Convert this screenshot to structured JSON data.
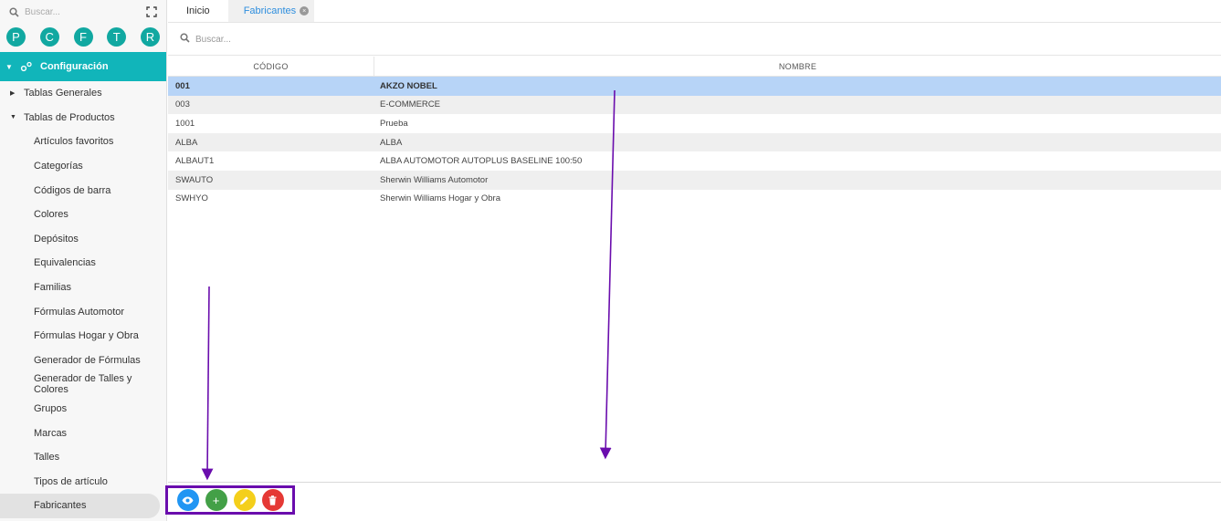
{
  "sidebar": {
    "search_placeholder": "Buscar...",
    "shortcuts": [
      "P",
      "C",
      "F",
      "T",
      "R"
    ],
    "section_title": "Configuración",
    "groups": [
      {
        "label": "Tablas Generales"
      },
      {
        "label": "Tablas de Productos"
      }
    ],
    "items": [
      {
        "label": "Artículos favoritos"
      },
      {
        "label": "Categorías"
      },
      {
        "label": "Códigos de barra"
      },
      {
        "label": "Colores"
      },
      {
        "label": "Depósitos"
      },
      {
        "label": "Equivalencias"
      },
      {
        "label": "Familias"
      },
      {
        "label": "Fórmulas Automotor"
      },
      {
        "label": "Fórmulas Hogar y Obra"
      },
      {
        "label": "Generador de Fórmulas"
      },
      {
        "label": "Generador de Talles y Colores"
      },
      {
        "label": "Grupos"
      },
      {
        "label": "Marcas"
      },
      {
        "label": "Talles"
      },
      {
        "label": "Tipos de artículo"
      },
      {
        "label": "Fabricantes"
      }
    ]
  },
  "tabs": [
    {
      "label": "Inicio"
    },
    {
      "label": "Fabricantes",
      "close": "×"
    }
  ],
  "main": {
    "search_placeholder": "Buscar...",
    "columns": [
      "CÓDIGO",
      "NOMBRE"
    ],
    "rows": [
      {
        "code": "001",
        "name": "AKZO NOBEL"
      },
      {
        "code": "003",
        "name": "E-COMMERCE"
      },
      {
        "code": "1001",
        "name": "Prueba"
      },
      {
        "code": "ALBA",
        "name": "ALBA"
      },
      {
        "code": "ALBAUT1",
        "name": "ALBA AUTOMOTOR AUTOPLUS BASELINE 100:50"
      },
      {
        "code": "SWAUTO",
        "name": "Sherwin Williams Automotor"
      },
      {
        "code": "SWHYO",
        "name": "Sherwin Williams Hogar y Obra"
      }
    ],
    "selected_row": 0
  },
  "toolbar": {
    "add_glyph": "+",
    "colors": {
      "view": "#2196f3",
      "add": "#43a047",
      "edit": "#f4cf1b",
      "delete": "#e53935"
    }
  },
  "colors": {
    "accent": "#11b5ba",
    "shortcut": "#11a8a1",
    "selection": "#b7d4f7",
    "annotation": "#6a0dad"
  }
}
